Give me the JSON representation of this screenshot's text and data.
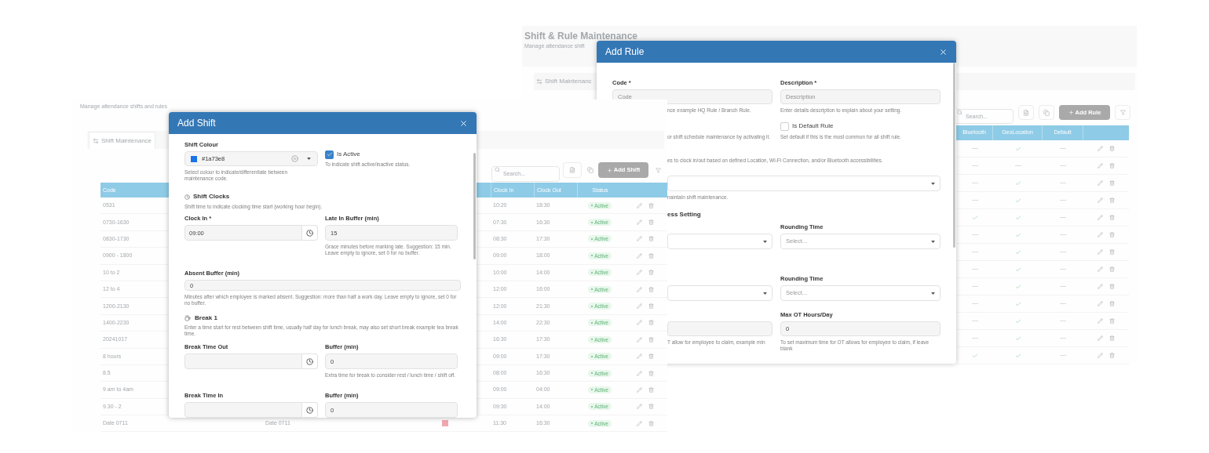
{
  "rule_page": {
    "title": "Shift & Rule Maintenance",
    "subtitle": "Manage attendance shift",
    "tab": "Shift Maintenanc",
    "search_placeholder": "Search...",
    "add_button": "Add Rule",
    "columns": [
      "Bluetooth",
      "GeoLocation",
      "Default"
    ],
    "rows": [
      {
        "bluetooth": false,
        "geolocation": true,
        "default": false
      },
      {
        "bluetooth": false,
        "geolocation": false,
        "default": false
      },
      {
        "bluetooth": false,
        "geolocation": true,
        "default": false
      },
      {
        "bluetooth": false,
        "geolocation": true,
        "default": false
      },
      {
        "bluetooth": true,
        "geolocation": true,
        "default": false
      },
      {
        "bluetooth": false,
        "geolocation": true,
        "default": false
      },
      {
        "bluetooth": false,
        "geolocation": true,
        "default": false
      },
      {
        "bluetooth": false,
        "geolocation": true,
        "default": false
      },
      {
        "bluetooth": false,
        "geolocation": true,
        "default": false
      },
      {
        "bluetooth": false,
        "geolocation": true,
        "default": false
      },
      {
        "bluetooth": false,
        "geolocation": true,
        "default": false
      },
      {
        "bluetooth": false,
        "geolocation": true,
        "default": false
      },
      {
        "bluetooth": true,
        "geolocation": true,
        "default": false
      }
    ]
  },
  "add_rule_modal": {
    "title": "Add Rule",
    "code_label": "Code *",
    "code_placeholder": "Code",
    "code_hint": "nce example HQ Rule / Branch Rule.",
    "description_label": "Description *",
    "description_placeholder": "Description",
    "description_hint": "Enter details description to explain about your setting.",
    "active_hint": "or shift schedule maintenance by activating it.",
    "default_rule": {
      "label": "Is Default Rule",
      "checked": false,
      "hint": "Set default if this is the most common for all shift rule."
    },
    "access_hint": "es to clock in/out based on defined Location, Wi-Fi Connection, and/or Bluetooth accessibilities.",
    "shift_select_hint": "naintain shift maintenance.",
    "section_heading": "ess Setting",
    "rounding": [
      {
        "label": "Rounding Time",
        "placeholder": "Select..."
      },
      {
        "label": "Rounding Time",
        "placeholder": "Select..."
      }
    ],
    "max_ot": {
      "label": "Max OT Hours/Day",
      "value": "0",
      "hint": "To set maximum time for OT allows for employee to claim, if leave blank"
    },
    "ot_hint": "T allow for employee to claim, example min"
  },
  "shift_page": {
    "subtitle": "Manage attendance shifts and rules",
    "tabs": [
      {
        "label": "Shift Maintenance",
        "selected": true
      }
    ],
    "search_placeholder": "Search...",
    "add_button": "Add Shift",
    "columns": {
      "code": "Code",
      "clock_in": "Clock In",
      "clock_out": "Clock Out",
      "status": "Status"
    },
    "rows": [
      {
        "code": "0531",
        "clock_in": "10:20",
        "clock_out": "18:30",
        "status": "Active"
      },
      {
        "code": "0730-1630",
        "clock_in": "07:30",
        "clock_out": "16:30",
        "status": "Active"
      },
      {
        "code": "0830-1730",
        "clock_in": "08:30",
        "clock_out": "17:30",
        "status": "Active"
      },
      {
        "code": "0900 - 1800",
        "clock_in": "09:00",
        "clock_out": "18:00",
        "status": "Active"
      },
      {
        "code": "10 to 2",
        "clock_in": "10:00",
        "clock_out": "14:00",
        "status": "Active"
      },
      {
        "code": "12 to 4",
        "clock_in": "12:00",
        "clock_out": "16:00",
        "status": "Active"
      },
      {
        "code": "1200-2130",
        "clock_in": "12:00",
        "clock_out": "21:30",
        "status": "Active"
      },
      {
        "code": "1400-2230",
        "clock_in": "14:00",
        "clock_out": "22:30",
        "status": "Active"
      },
      {
        "code": "20241017",
        "clock_in": "16:30",
        "clock_out": "17:30",
        "status": "Active"
      },
      {
        "code": "8 hours",
        "clock_in": "09:00",
        "clock_out": "17:30",
        "status": "Active"
      },
      {
        "code": "8.5",
        "clock_in": "08:00",
        "clock_out": "16:30",
        "status": "Active"
      },
      {
        "code": "9 am to 4am",
        "clock_in": "09:00",
        "clock_out": "04:00",
        "status": "Active"
      },
      {
        "code": "9.30 - 2",
        "clock_in": "09:30",
        "clock_out": "14:00",
        "status": "Active"
      },
      {
        "code": "Date 0711",
        "description": "Date 0711",
        "color": "#f2a7b0",
        "clock_in": "11:30",
        "clock_out": "16:30",
        "status": "Active"
      }
    ]
  },
  "add_shift_modal": {
    "title": "Add Shift",
    "colour": {
      "label": "Shift Colour",
      "value": "#1a73e8",
      "color": "#1a73e8",
      "hint": "Select colour to indicate/differentiate between maintenance code."
    },
    "is_active": {
      "label": "Is Active",
      "checked": true,
      "hint": "To indicate shift active/inactive status."
    },
    "shift_clocks": {
      "title": "Shift Clocks",
      "hint": "Shift time to indicate clocking time start (working hour begin)."
    },
    "clock_in": {
      "label": "Clock In *",
      "value": "09:00"
    },
    "late_in_buffer": {
      "label": "Late In Buffer (min)",
      "value": "15",
      "hint": "Grace minutes before marking late. Suggestion: 15 min. Leave empty to ignore, set 0 for no buffer."
    },
    "absent_buffer": {
      "label": "Absent Buffer (min)",
      "value": "0",
      "hint": "Minutes after which employee is marked absent. Suggestion: more than half a work day. Leave empty to ignore, set 0 for no buffer."
    },
    "break": {
      "title": "Break 1",
      "hint": "Enter a time start for rest between shift time, usually half day for lunch break, may also set short break example tea break time."
    },
    "break_out": {
      "label": "Break Time Out",
      "buffer_label": "Buffer (min)",
      "buffer_value": "0",
      "buffer_hint": "Extra time for break to consider rest / lunch time / shift off."
    },
    "break_in": {
      "label": "Break Time In",
      "buffer_label": "Buffer (min)",
      "buffer_value": "0"
    }
  }
}
